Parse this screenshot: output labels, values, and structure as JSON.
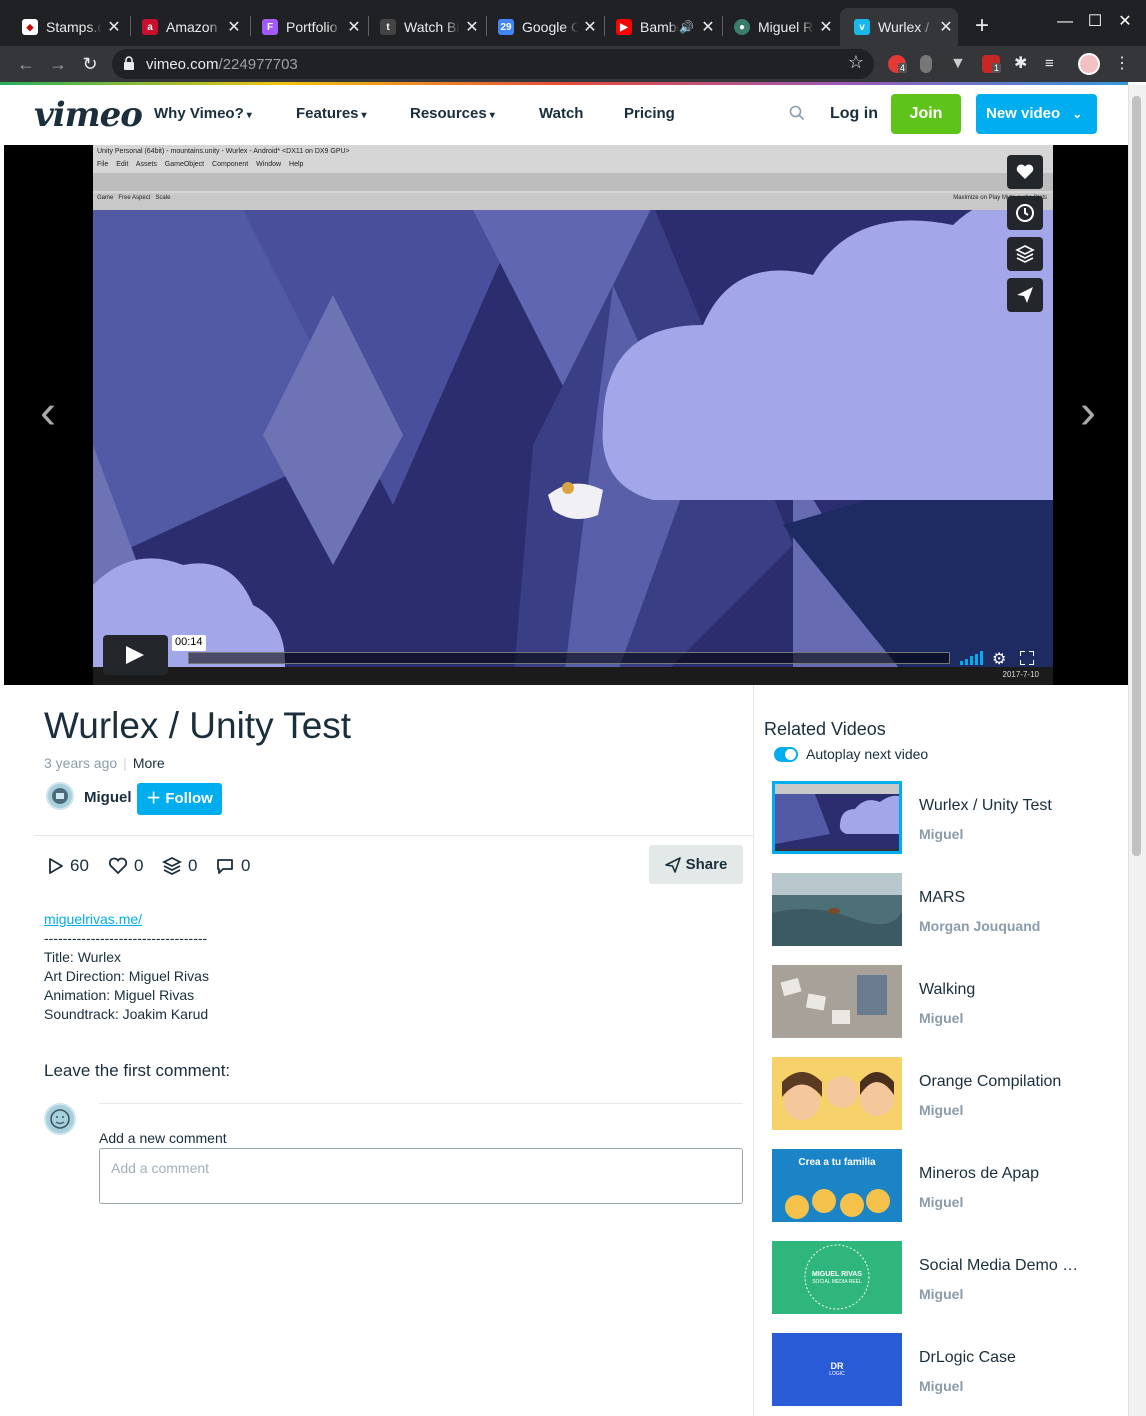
{
  "browser": {
    "tabs": [
      {
        "title": "Stamps.com",
        "icon": "stamps-favicon"
      },
      {
        "title": "Amazon Prime",
        "icon": "amazon-favicon"
      },
      {
        "title": "Portfolio",
        "icon": "figma-favicon"
      },
      {
        "title": "Watch Big",
        "icon": "watch-favicon"
      },
      {
        "title": "Google Calendar",
        "icon": "google-calendar-favicon"
      },
      {
        "title": "Bamboo",
        "icon": "youtube-favicon"
      },
      {
        "title": "Miguel Rivas",
        "icon": "globe-favicon"
      },
      {
        "title": "Wurlex / Unity Test",
        "icon": "vimeo-favicon",
        "active": true
      }
    ],
    "url_host": "vimeo.com",
    "url_path": "/224977703",
    "extension_badges": [
      "4",
      "1"
    ]
  },
  "vimeo_header": {
    "logo": "vimeo",
    "nav": [
      "Why Vimeo?",
      "Features",
      "Resources",
      "Watch",
      "Pricing"
    ],
    "login": "Log in",
    "join": "Join",
    "new_video": "New video",
    "brand_green": "#5ec41a",
    "brand_blue": "#00adef"
  },
  "player": {
    "unity_window_title": "Unity Personal (64bit) - mountains.unity - Wurlex - Android* <DX11 on DX9 GPU>",
    "unity_menu": "File Edit Assets GameObject Component Window Help",
    "unity_game_tab": "Game",
    "unity_aspect": "Free Aspect",
    "unity_scale": "Scale",
    "unity_right": "Maximize on Play  Mute audio  Stats",
    "timecode": "00:14",
    "taskbar_date": "2017-7-10",
    "side_buttons": [
      "heart-icon",
      "clock-icon",
      "layers-icon",
      "send-icon"
    ]
  },
  "video": {
    "title": "Wurlex / Unity Test",
    "age": "3 years ago",
    "more": "More",
    "uploader": "Miguel",
    "follow": "Follow",
    "stats": {
      "plays": "60",
      "likes": "0",
      "collections": "0",
      "comments": "0"
    },
    "share": "Share",
    "description": {
      "link": "miguelrivas.me/",
      "rule": "-----------------------------------",
      "lines": [
        "Title: Wurlex",
        "Art Direction: Miguel Rivas",
        "Animation: Miguel Rivas",
        "Soundtrack: Joakim Karud"
      ]
    }
  },
  "comments": {
    "heading": "Leave the first comment:",
    "label": "Add a new comment",
    "placeholder": "Add a comment"
  },
  "related": {
    "heading": "Related Videos",
    "autoplay": "Autoplay next video",
    "autoplay_on": true,
    "items": [
      {
        "title": "Wurlex / Unity Test",
        "author": "Miguel"
      },
      {
        "title": "MARS",
        "author": "Morgan Jouquand"
      },
      {
        "title": "Walking",
        "author": "Miguel"
      },
      {
        "title": "Orange Compilation",
        "author": "Miguel"
      },
      {
        "title": "Mineros de Apap",
        "author": "Miguel"
      },
      {
        "title": "Social Media Demo Reel",
        "author": "Miguel"
      },
      {
        "title": "DrLogic Case",
        "author": "Miguel"
      }
    ],
    "thumb_text": {
      "mineros": "Crea a tu familia",
      "social_1": "MIGUEL RIVAS",
      "social_2": "SOCIAL MEDIA REEL",
      "drlogic_1": "DR",
      "drlogic_2": "LOGIC"
    }
  }
}
